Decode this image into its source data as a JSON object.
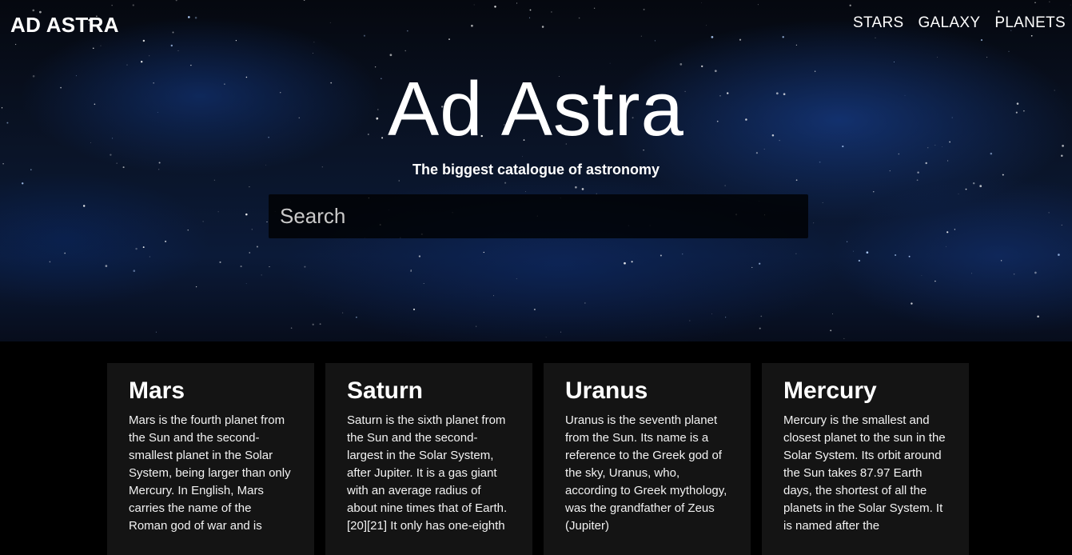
{
  "header": {
    "brand": "AD ASTRA",
    "nav": [
      {
        "label": "STARS"
      },
      {
        "label": "GALAXY"
      },
      {
        "label": "PLANETS"
      }
    ]
  },
  "hero": {
    "title": "Ad Astra",
    "subtitle": "The biggest catalogue of astronomy",
    "search_placeholder": "Search"
  },
  "cards": [
    {
      "title": "Mars",
      "text": "Mars is the fourth planet from the Sun and the second-smallest planet in the Solar System, being larger than only Mercury. In English, Mars carries the name of the Roman god of war and is"
    },
    {
      "title": "Saturn",
      "text": "Saturn is the sixth planet from the Sun and the second-largest in the Solar System, after Jupiter. It is a gas giant with an average radius of about nine times that of Earth.[20][21] It only has one-eighth"
    },
    {
      "title": "Uranus",
      "text": "Uranus is the seventh planet from the Sun. Its name is a reference to the Greek god of the sky, Uranus, who, according to Greek mythology, was the grandfather of Zeus (Jupiter)"
    },
    {
      "title": "Mercury",
      "text": "Mercury is the smallest and closest planet to the sun in the Solar System. Its orbit around the Sun takes 87.97 Earth days, the shortest of all the planets in the Solar System. It is named after the"
    }
  ]
}
